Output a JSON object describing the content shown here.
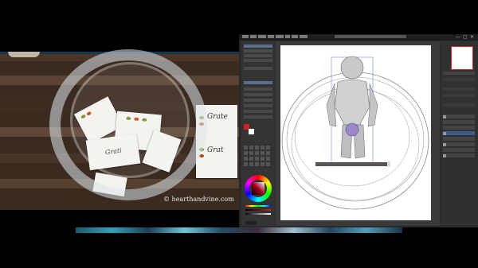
{
  "photo": {
    "watermark": "© hearthandvine.com",
    "notes": [
      "Grate",
      "Grat",
      "Grati"
    ]
  },
  "app": {
    "menu_count": 8,
    "window_controls": [
      "—",
      "▢",
      "✕"
    ]
  },
  "colors": {
    "accent_blue": "#3e5c88",
    "red_swatch_border": "#dd2222",
    "wood": "#3b2a20"
  },
  "icons": [
    "color-wheel-icon",
    "layer-visibility-icon",
    "close-icon",
    "minimize-icon",
    "maximize-icon"
  ]
}
